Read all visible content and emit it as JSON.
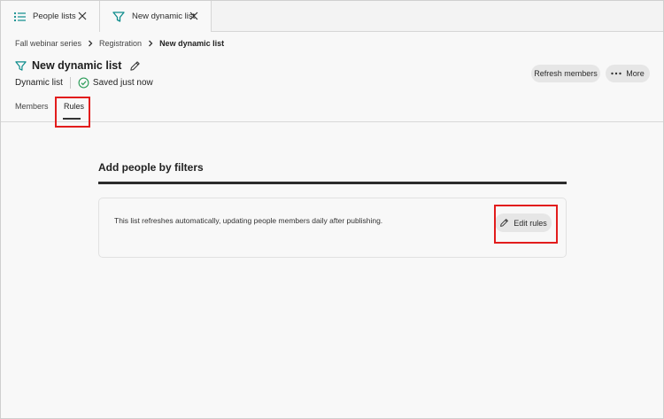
{
  "tabs": [
    {
      "label": "People lists",
      "icon": "list-icon"
    },
    {
      "label": "New dynamic list",
      "icon": "filter-icon"
    }
  ],
  "breadcrumb": [
    "Fall webinar series",
    "Registration",
    "New dynamic list"
  ],
  "header": {
    "title": "New dynamic list",
    "type_label": "Dynamic list",
    "save_status": "Saved just now",
    "refresh_label": "Refresh members",
    "more_label": "More"
  },
  "nav": {
    "members": "Members",
    "rules": "Rules",
    "active": "Rules"
  },
  "section": {
    "title": "Add people by filters",
    "description": "This list refreshes automatically, updating people members daily after publishing.",
    "edit_label": "Edit rules"
  },
  "colors": {
    "accent": "#0d8c8c",
    "highlight": "#e21c1c",
    "success": "#2d9d5a"
  }
}
